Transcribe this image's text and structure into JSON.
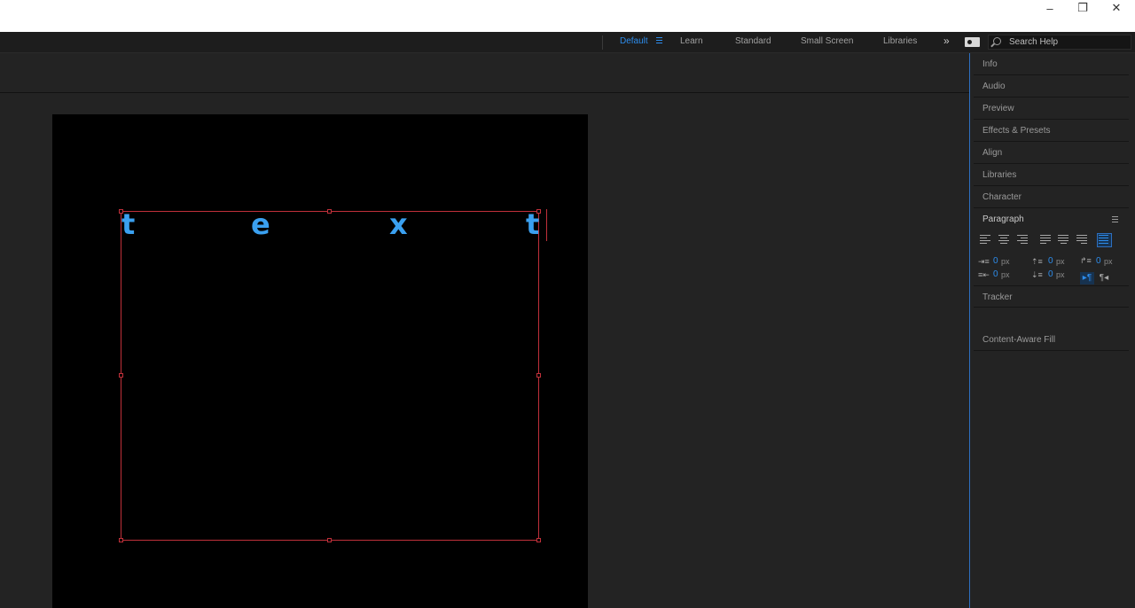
{
  "window": {
    "minimize_glyph": "–",
    "maximize_glyph": "❐",
    "close_glyph": "✕"
  },
  "workspaces": {
    "items": [
      "Default",
      "Learn",
      "Standard",
      "Small Screen",
      "Libraries"
    ],
    "active": "Default",
    "overflow_glyph": "»",
    "search_placeholder": "Search Help"
  },
  "canvas": {
    "glyphs": [
      "t",
      "e",
      "x",
      "t"
    ],
    "text_color": "#3aa0f0",
    "box_color": "#c0303a"
  },
  "side_panel": {
    "items_top": [
      "Info",
      "Audio",
      "Preview",
      "Effects & Presets",
      "Align",
      "Libraries",
      "Character"
    ],
    "open_panel": "Paragraph",
    "items_bottom": [
      "Tracker",
      "Content-Aware Fill"
    ],
    "paragraph": {
      "indent_left": "0",
      "indent_right": "0",
      "indent_first_line": "0",
      "space_before": "0",
      "space_after": "0",
      "unit": "px",
      "rtl_glyph": "▸¶",
      "ltr_glyph": "¶◂"
    }
  },
  "colors": {
    "accent": "#2d8ceb",
    "panel_bg": "#232323"
  }
}
